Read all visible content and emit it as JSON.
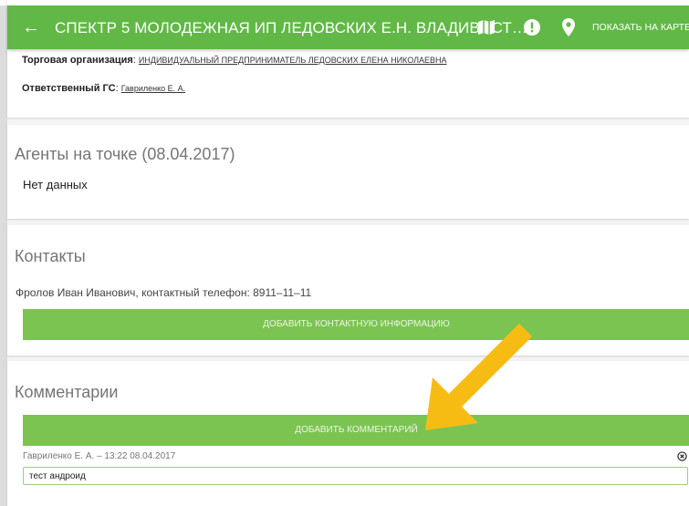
{
  "top_sliver_text": "…",
  "appbar": {
    "title": "СПЕКТР 5 МОЛОДЕЖНАЯ ИП ЛЕДОВСКИХ Е.Н. ВЛАДИВОСТ…",
    "show_on_map_label": "ПОКАЗАТЬ НА КАРТЕ",
    "icons": [
      "back-arrow-icon",
      "map-icon",
      "alert-icon",
      "location-pin-icon"
    ],
    "color": "#62b846"
  },
  "info": {
    "org_label": "Торговая организация",
    "org_value": "ИНДИВИДУАЛЬНЫЙ ПРЕДПРИНИМАТЕЛЬ ЛЕДОВСКИХ ЕЛЕНА НИКОЛАЕВНА",
    "responsible_label": "Ответственный ГС",
    "responsible_value": "Гавриленко Е. А."
  },
  "agents": {
    "title": "Агенты на точке (08.04.2017)",
    "empty_text": "Нет данных"
  },
  "contacts": {
    "title": "Контакты",
    "entry": "Фролов  Иван Иванович, контактный телефон: 8911–11–11",
    "add_button": "ДОБАВИТЬ КОНТАКТНУЮ ИНФОРМАЦИЮ"
  },
  "comments": {
    "title": "Комментарии",
    "add_button": "ДОБАВИТЬ КОММЕНТАРИЙ",
    "items": [
      {
        "meta": "Гавриленко Е. А. – 13:22 08.04.2017",
        "text": "тест андроид"
      }
    ]
  },
  "colors": {
    "accent": "#62b846",
    "button": "#7cc452",
    "arrow": "#f7bc14"
  }
}
